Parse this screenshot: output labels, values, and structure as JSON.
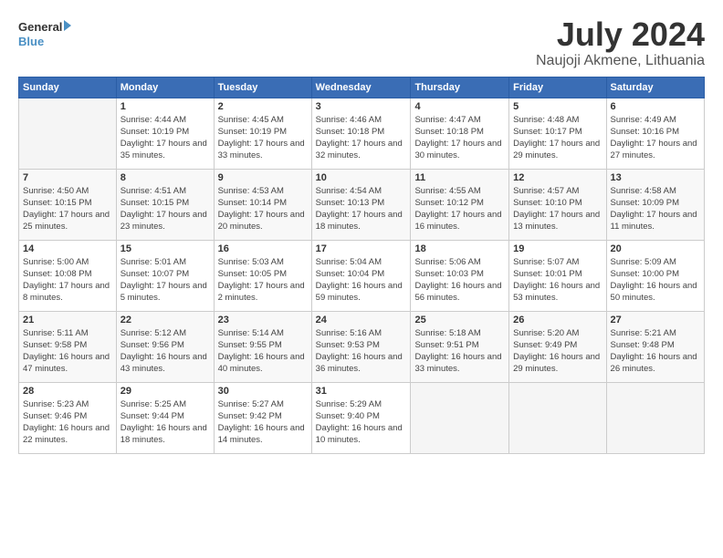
{
  "logo": {
    "line1": "General",
    "line2": "Blue"
  },
  "title": "July 2024",
  "location": "Naujoji Akmene, Lithuania",
  "days_of_week": [
    "Sunday",
    "Monday",
    "Tuesday",
    "Wednesday",
    "Thursday",
    "Friday",
    "Saturday"
  ],
  "weeks": [
    [
      {
        "day": "",
        "sunrise": "",
        "sunset": "",
        "daylight": ""
      },
      {
        "day": "1",
        "sunrise": "Sunrise: 4:44 AM",
        "sunset": "Sunset: 10:19 PM",
        "daylight": "Daylight: 17 hours and 35 minutes."
      },
      {
        "day": "2",
        "sunrise": "Sunrise: 4:45 AM",
        "sunset": "Sunset: 10:19 PM",
        "daylight": "Daylight: 17 hours and 33 minutes."
      },
      {
        "day": "3",
        "sunrise": "Sunrise: 4:46 AM",
        "sunset": "Sunset: 10:18 PM",
        "daylight": "Daylight: 17 hours and 32 minutes."
      },
      {
        "day": "4",
        "sunrise": "Sunrise: 4:47 AM",
        "sunset": "Sunset: 10:18 PM",
        "daylight": "Daylight: 17 hours and 30 minutes."
      },
      {
        "day": "5",
        "sunrise": "Sunrise: 4:48 AM",
        "sunset": "Sunset: 10:17 PM",
        "daylight": "Daylight: 17 hours and 29 minutes."
      },
      {
        "day": "6",
        "sunrise": "Sunrise: 4:49 AM",
        "sunset": "Sunset: 10:16 PM",
        "daylight": "Daylight: 17 hours and 27 minutes."
      }
    ],
    [
      {
        "day": "7",
        "sunrise": "Sunrise: 4:50 AM",
        "sunset": "Sunset: 10:15 PM",
        "daylight": "Daylight: 17 hours and 25 minutes."
      },
      {
        "day": "8",
        "sunrise": "Sunrise: 4:51 AM",
        "sunset": "Sunset: 10:15 PM",
        "daylight": "Daylight: 17 hours and 23 minutes."
      },
      {
        "day": "9",
        "sunrise": "Sunrise: 4:53 AM",
        "sunset": "Sunset: 10:14 PM",
        "daylight": "Daylight: 17 hours and 20 minutes."
      },
      {
        "day": "10",
        "sunrise": "Sunrise: 4:54 AM",
        "sunset": "Sunset: 10:13 PM",
        "daylight": "Daylight: 17 hours and 18 minutes."
      },
      {
        "day": "11",
        "sunrise": "Sunrise: 4:55 AM",
        "sunset": "Sunset: 10:12 PM",
        "daylight": "Daylight: 17 hours and 16 minutes."
      },
      {
        "day": "12",
        "sunrise": "Sunrise: 4:57 AM",
        "sunset": "Sunset: 10:10 PM",
        "daylight": "Daylight: 17 hours and 13 minutes."
      },
      {
        "day": "13",
        "sunrise": "Sunrise: 4:58 AM",
        "sunset": "Sunset: 10:09 PM",
        "daylight": "Daylight: 17 hours and 11 minutes."
      }
    ],
    [
      {
        "day": "14",
        "sunrise": "Sunrise: 5:00 AM",
        "sunset": "Sunset: 10:08 PM",
        "daylight": "Daylight: 17 hours and 8 minutes."
      },
      {
        "day": "15",
        "sunrise": "Sunrise: 5:01 AM",
        "sunset": "Sunset: 10:07 PM",
        "daylight": "Daylight: 17 hours and 5 minutes."
      },
      {
        "day": "16",
        "sunrise": "Sunrise: 5:03 AM",
        "sunset": "Sunset: 10:05 PM",
        "daylight": "Daylight: 17 hours and 2 minutes."
      },
      {
        "day": "17",
        "sunrise": "Sunrise: 5:04 AM",
        "sunset": "Sunset: 10:04 PM",
        "daylight": "Daylight: 16 hours and 59 minutes."
      },
      {
        "day": "18",
        "sunrise": "Sunrise: 5:06 AM",
        "sunset": "Sunset: 10:03 PM",
        "daylight": "Daylight: 16 hours and 56 minutes."
      },
      {
        "day": "19",
        "sunrise": "Sunrise: 5:07 AM",
        "sunset": "Sunset: 10:01 PM",
        "daylight": "Daylight: 16 hours and 53 minutes."
      },
      {
        "day": "20",
        "sunrise": "Sunrise: 5:09 AM",
        "sunset": "Sunset: 10:00 PM",
        "daylight": "Daylight: 16 hours and 50 minutes."
      }
    ],
    [
      {
        "day": "21",
        "sunrise": "Sunrise: 5:11 AM",
        "sunset": "Sunset: 9:58 PM",
        "daylight": "Daylight: 16 hours and 47 minutes."
      },
      {
        "day": "22",
        "sunrise": "Sunrise: 5:12 AM",
        "sunset": "Sunset: 9:56 PM",
        "daylight": "Daylight: 16 hours and 43 minutes."
      },
      {
        "day": "23",
        "sunrise": "Sunrise: 5:14 AM",
        "sunset": "Sunset: 9:55 PM",
        "daylight": "Daylight: 16 hours and 40 minutes."
      },
      {
        "day": "24",
        "sunrise": "Sunrise: 5:16 AM",
        "sunset": "Sunset: 9:53 PM",
        "daylight": "Daylight: 16 hours and 36 minutes."
      },
      {
        "day": "25",
        "sunrise": "Sunrise: 5:18 AM",
        "sunset": "Sunset: 9:51 PM",
        "daylight": "Daylight: 16 hours and 33 minutes."
      },
      {
        "day": "26",
        "sunrise": "Sunrise: 5:20 AM",
        "sunset": "Sunset: 9:49 PM",
        "daylight": "Daylight: 16 hours and 29 minutes."
      },
      {
        "day": "27",
        "sunrise": "Sunrise: 5:21 AM",
        "sunset": "Sunset: 9:48 PM",
        "daylight": "Daylight: 16 hours and 26 minutes."
      }
    ],
    [
      {
        "day": "28",
        "sunrise": "Sunrise: 5:23 AM",
        "sunset": "Sunset: 9:46 PM",
        "daylight": "Daylight: 16 hours and 22 minutes."
      },
      {
        "day": "29",
        "sunrise": "Sunrise: 5:25 AM",
        "sunset": "Sunset: 9:44 PM",
        "daylight": "Daylight: 16 hours and 18 minutes."
      },
      {
        "day": "30",
        "sunrise": "Sunrise: 5:27 AM",
        "sunset": "Sunset: 9:42 PM",
        "daylight": "Daylight: 16 hours and 14 minutes."
      },
      {
        "day": "31",
        "sunrise": "Sunrise: 5:29 AM",
        "sunset": "Sunset: 9:40 PM",
        "daylight": "Daylight: 16 hours and 10 minutes."
      },
      {
        "day": "",
        "sunrise": "",
        "sunset": "",
        "daylight": ""
      },
      {
        "day": "",
        "sunrise": "",
        "sunset": "",
        "daylight": ""
      },
      {
        "day": "",
        "sunrise": "",
        "sunset": "",
        "daylight": ""
      }
    ]
  ]
}
